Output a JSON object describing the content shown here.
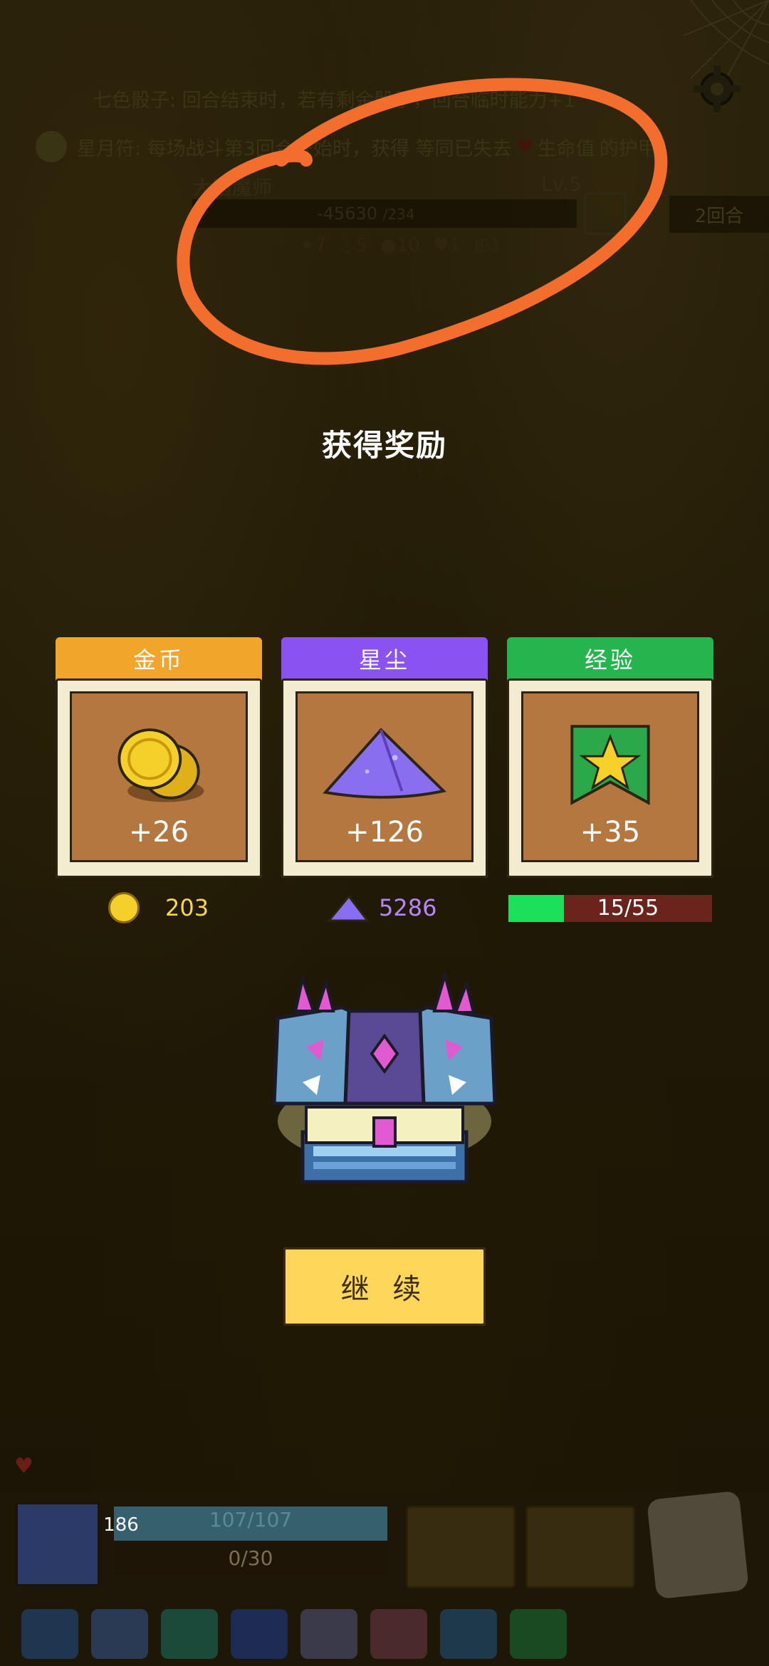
{
  "top_info": {
    "buff1": "七色骰子: 回合结束时，若有剩余骰子，回合临时能力+1",
    "buff2": "星月符: 每场战斗第3回合开始时，获得 等同已失去",
    "buff2_heart_label": "生命值",
    "buff2_tail": "的护甲",
    "enemy_name": "大猎魔师",
    "enemy_level": "Lv.5",
    "enemy_hp": "-45630",
    "enemy_hp_max": "/234",
    "round": "2回合",
    "stats": [
      "7",
      "5",
      "10",
      "1",
      "1"
    ]
  },
  "reward": {
    "title": "获得奖励",
    "cards": [
      {
        "header": "金币",
        "amount": "+26",
        "color": "#f1a52a"
      },
      {
        "header": "星尘",
        "amount": "+126",
        "color": "#8a52f0"
      },
      {
        "header": "经验",
        "amount": "+35",
        "color": "#26b44f"
      }
    ],
    "totals": {
      "gold": "203",
      "stardust": "5286",
      "xp": "15/55",
      "xp_fraction": 0.2727
    }
  },
  "continue_label": "继 续",
  "hud": {
    "hp": "107/107",
    "shield_value": "186",
    "armor": "0/30"
  },
  "colors": {
    "annotation": "#f36e2c",
    "gold_text": "#f5d84a",
    "stardust_text": "#b687f5",
    "xp_fill": "#1de05a",
    "xp_empty": "#6b241c",
    "button": "#fed65a"
  }
}
